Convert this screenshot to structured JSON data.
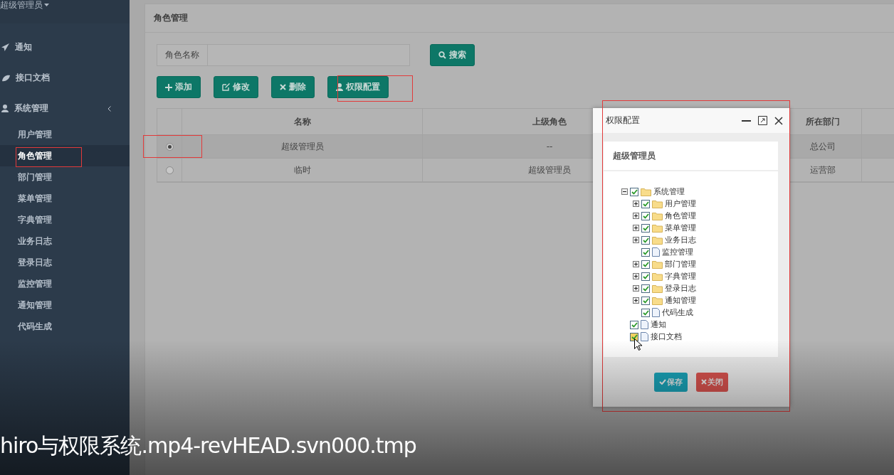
{
  "user_menu": {
    "label": "超级管理员"
  },
  "sidebar": {
    "items": [
      {
        "label": "通知",
        "selected": false
      },
      {
        "label": "接口文档",
        "selected": false
      },
      {
        "label": "系统管理",
        "selected": false,
        "children": [
          {
            "label": "用户管理",
            "selected": false
          },
          {
            "label": "角色管理",
            "selected": true
          },
          {
            "label": "部门管理",
            "selected": false
          },
          {
            "label": "菜单管理",
            "selected": false
          },
          {
            "label": "字典管理",
            "selected": false
          },
          {
            "label": "业务日志",
            "selected": false
          },
          {
            "label": "登录日志",
            "selected": false
          },
          {
            "label": "监控管理",
            "selected": false
          },
          {
            "label": "通知管理",
            "selected": false
          },
          {
            "label": "代码生成",
            "selected": false
          }
        ]
      }
    ]
  },
  "panel": {
    "title": "角色管理"
  },
  "search": {
    "label": "角色名称",
    "button": "搜索"
  },
  "toolbar": [
    "添加",
    "修改",
    "删除",
    "权限配置"
  ],
  "table": {
    "columns": [
      "名称",
      "上级角色",
      "所在部门"
    ],
    "rows": [
      {
        "selected": true,
        "cells": [
          "超级管理员",
          "--",
          "总公司"
        ]
      },
      {
        "selected": false,
        "cells": [
          "临时",
          "超级管理员",
          "运营部"
        ]
      }
    ]
  },
  "dialog": {
    "title": "权限配置",
    "card_title": "超级管理员",
    "tree": [
      {
        "label": "系统管理",
        "kind": "folder",
        "checked": true,
        "expanded": true,
        "hovered": false,
        "children": [
          {
            "label": "用户管理",
            "kind": "folder",
            "checked": true,
            "expanded": false,
            "hovered": false
          },
          {
            "label": "角色管理",
            "kind": "folder",
            "checked": true,
            "expanded": false,
            "hovered": false
          },
          {
            "label": "菜单管理",
            "kind": "folder",
            "checked": true,
            "expanded": false,
            "hovered": false
          },
          {
            "label": "业务日志",
            "kind": "folder",
            "checked": true,
            "expanded": false,
            "hovered": false
          },
          {
            "label": "监控管理",
            "kind": "file",
            "checked": true,
            "hovered": false
          },
          {
            "label": "部门管理",
            "kind": "folder",
            "checked": true,
            "expanded": false,
            "hovered": false
          },
          {
            "label": "字典管理",
            "kind": "folder",
            "checked": true,
            "expanded": false,
            "hovered": false
          },
          {
            "label": "登录日志",
            "kind": "folder",
            "checked": true,
            "expanded": false,
            "hovered": false
          },
          {
            "label": "通知管理",
            "kind": "folder",
            "checked": true,
            "expanded": false,
            "hovered": false
          },
          {
            "label": "代码生成",
            "kind": "file",
            "checked": true,
            "hovered": false
          }
        ]
      },
      {
        "label": "通知",
        "kind": "file",
        "checked": true,
        "hovered": false
      },
      {
        "label": "接口文档",
        "kind": "file",
        "checked": true,
        "hovered": true
      }
    ],
    "buttons": [
      {
        "label": "保存",
        "kind": "primary"
      },
      {
        "label": "关闭",
        "kind": "danger"
      }
    ]
  },
  "video_caption": "hiro与权限系统.mp4-revHEAD.svn000.tmp"
}
